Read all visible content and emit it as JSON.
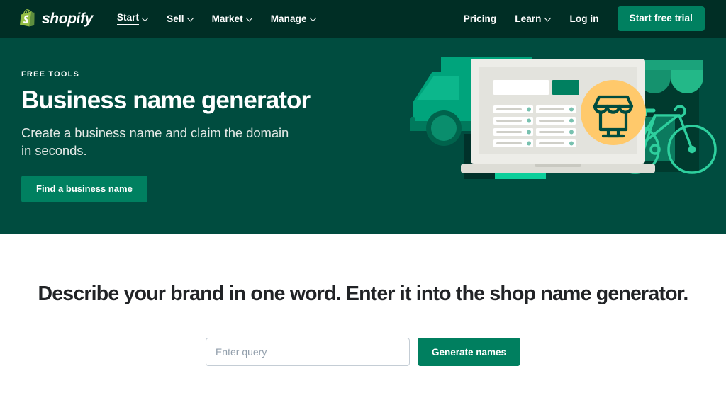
{
  "header": {
    "logo": {
      "icon": "shopify-bag-icon",
      "wordmark": "shopify"
    },
    "nav_left": [
      {
        "label": "Start",
        "has_chevron": true,
        "active": true
      },
      {
        "label": "Sell",
        "has_chevron": true,
        "active": false
      },
      {
        "label": "Market",
        "has_chevron": true,
        "active": false
      },
      {
        "label": "Manage",
        "has_chevron": true,
        "active": false
      }
    ],
    "nav_right": [
      {
        "label": "Pricing",
        "has_chevron": false
      },
      {
        "label": "Learn",
        "has_chevron": true
      },
      {
        "label": "Log in",
        "has_chevron": false
      }
    ],
    "cta": "Start free trial",
    "bg_color": "#002E25"
  },
  "hero": {
    "eyebrow": "FREE TOOLS",
    "title": "Business name generator",
    "subtitle": "Create a business name and claim the domain in seconds.",
    "cta": "Find a business name",
    "bg_color": "#004C3F",
    "cta_color": "#008060",
    "illustration": {
      "name": "ecommerce-laptop-illustration",
      "elements": [
        "delivery-truck",
        "shipping-boxes",
        "laptop-screen",
        "storefront",
        "bicycle",
        "shop-badge"
      ],
      "badge_color": "#FFC96B",
      "truck_color": "#00A47C",
      "accent_green": "#00B887"
    }
  },
  "main": {
    "heading": "Describe your brand in one word. Enter it into the shop name generator.",
    "form": {
      "input_placeholder": "Enter query",
      "input_value": "",
      "submit_label": "Generate names",
      "submit_color": "#007F5F"
    }
  }
}
